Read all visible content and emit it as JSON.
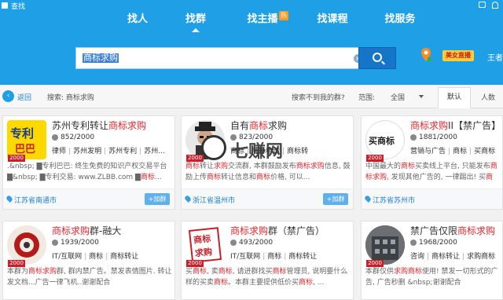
{
  "topbar": {
    "search_text": "查找"
  },
  "nav": {
    "items": [
      {
        "label": "找人"
      },
      {
        "label": "找群"
      },
      {
        "label": "找主播",
        "badge": "热"
      },
      {
        "label": "找课程"
      },
      {
        "label": "找服务"
      }
    ],
    "active_index": 1
  },
  "search": {
    "value": "商标求购",
    "clear_icon": "×"
  },
  "header_right": {
    "live_badge": "美女直播",
    "user_name": "王者"
  },
  "filter": {
    "back_label": "返回",
    "search_label": "搜索: 商标求购",
    "cant_find": "搜索不到我的群?",
    "range_label": "范围:",
    "range_value": "全国",
    "sort_default": "默认",
    "sort_members": "人数"
  },
  "cards": [
    {
      "title_prefix": "苏州专利转让",
      "title_hl": "商标求购",
      "title_suffix": "",
      "count": "852/2000",
      "tags": [
        "律师",
        "苏州发明",
        "苏州专利",
        "苏州..."
      ],
      "desc": ".&nbsp;  ▇专利巴巴: 终生免费的知识产权交易平台▇&nbsp;  ▇专利交易: www.ZLBB.com ▇商标...",
      "location": "江苏省南通市",
      "thumb_text": "专利",
      "thumb_sub": "巴巴",
      "thumb_tag": "2000"
    },
    {
      "title_prefix": "自有",
      "title_hl": "商标",
      "title_mid": "求购",
      "title_suffix": "",
      "count": "823/2000",
      "tags": [
        "商标",
        "商标申请",
        "商标转"
      ],
      "desc_parts": [
        "商标",
        "转让",
        "求购",
        "交流群, 本群鼓励发布",
        "商标",
        "求购",
        "信息, 鼓励上传",
        "商标",
        "转让信息和",
        "商标",
        "价格, 可以..."
      ],
      "desc": "商标转让求购交流群, 本群鼓励发布商标求购信息, 鼓励上传商标转让信息和商标价格, 可以...",
      "location": "浙江省温州市",
      "thumb_tag": "2000"
    },
    {
      "title_prefix": "",
      "title_hl": "商标求购",
      "title_suffix": "II【禁广告】",
      "count": "1881/2000",
      "tags": [
        "营销与广告",
        "商标",
        "买商标"
      ],
      "desc": "中国最大的商标买卖线上平台, 只能发布商标求购, 发现其他广告的, 一律踢出! 买商标...",
      "location": "江苏省苏州市",
      "thumb_text": "买商标",
      "thumb_tag": "2000"
    },
    {
      "title_prefix": "",
      "title_hl": "商标求购",
      "title_suffix": "群-融大",
      "count": "1939/2000",
      "tags": [
        "IT/互联网",
        "商标",
        "商标转让"
      ],
      "desc": "本群为商标求购群, 群内禁广告。禁发表情图片. 转让发文档...广告一律飞机..谢谢配合",
      "location": "",
      "thumb_tag": "2000"
    },
    {
      "title_prefix": "",
      "title_hl": "商标求购",
      "title_suffix": "群（禁广告）",
      "count": "493/2000",
      "tags": [
        "IT/互联网",
        "商标",
        "商标转让"
      ],
      "desc": "买商标, 卖商标, 请进群找买商标管理员, 说明要什么样的买卖商标。本群主要提供低价买商标, ...",
      "location": "",
      "thumb_text": "商标",
      "thumb_sub": "求购",
      "thumb_tag": "2000"
    },
    {
      "title_prefix": "禁广告仅限",
      "title_hl": "商标求购",
      "title_suffix": "群",
      "count": "1968/2000",
      "tags": [
        "咨询",
        "商标转让",
        "求购商标"
      ],
      "desc": "本群仅供求购商标使用! 禁发一切形式的广告, 广告秒删 &nbsp;谢谢配合",
      "location": "",
      "thumb_tag": "2000"
    }
  ],
  "watermark": "七赚网",
  "colors": {
    "header_blue": "#1f9fe6",
    "highlight_red": "#e0262c",
    "button_blue": "#1575c9"
  }
}
